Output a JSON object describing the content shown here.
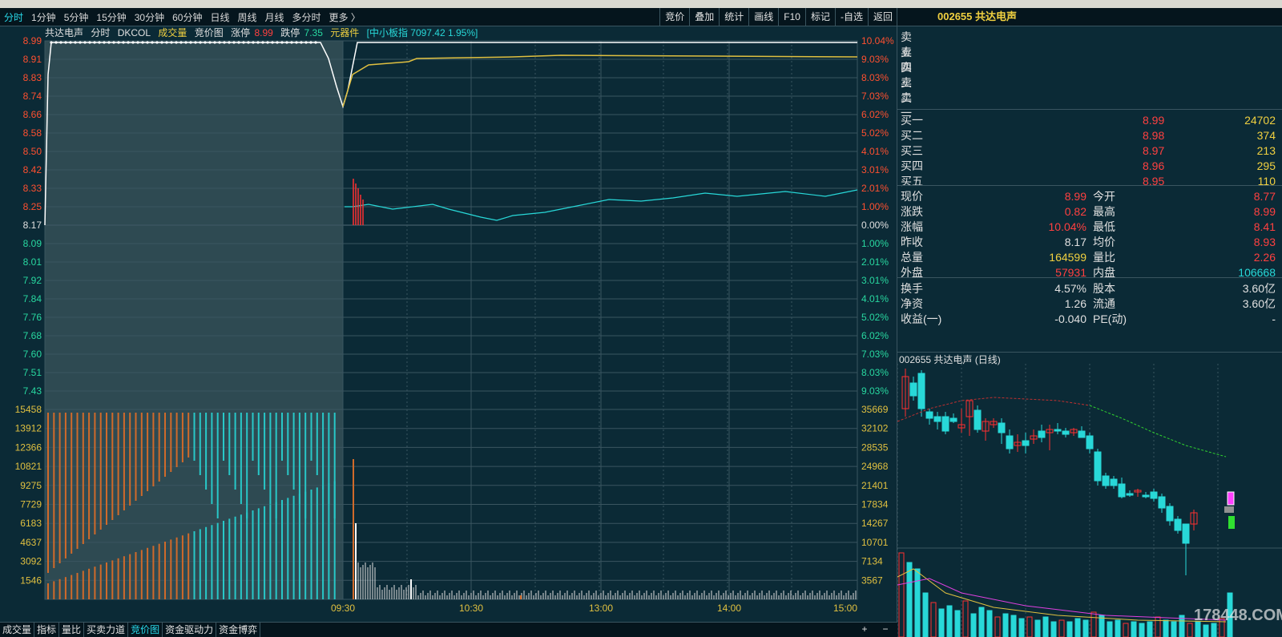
{
  "toolbar": {
    "periods": [
      "分时",
      "1分钟",
      "5分钟",
      "15分钟",
      "30分钟",
      "60分钟",
      "日线",
      "周线",
      "月线",
      "多分时",
      "更多 〉"
    ],
    "right_buttons": [
      "竞价",
      "叠加",
      "统计",
      "画线",
      "F10",
      "标记",
      "-自选",
      "返回"
    ]
  },
  "stock": {
    "code": "002655",
    "name": "共达电声",
    "header": "002655 共达电声"
  },
  "info_bar": {
    "name": "共达电声",
    "mode": "分时",
    "indicator": "DKCOL",
    "vol_label": "成交量",
    "auction_label": "竞价图",
    "limit_up_label": "涨停",
    "limit_up": "8.99",
    "limit_down_label": "跌停",
    "limit_down": "7.35",
    "sector": "元器件",
    "index": "[中小板指 7097.42 1.95%]"
  },
  "price_axis": [
    "8.99",
    "8.91",
    "8.83",
    "8.74",
    "8.66",
    "8.58",
    "8.50",
    "8.42",
    "8.33",
    "8.25",
    "8.17",
    "8.09",
    "8.01",
    "7.92",
    "7.84",
    "7.76",
    "7.68",
    "7.60",
    "7.51",
    "7.43"
  ],
  "pct_axis": [
    "10.04%",
    "9.03%",
    "8.03%",
    "7.03%",
    "6.02%",
    "5.02%",
    "4.01%",
    "3.01%",
    "2.01%",
    "1.00%",
    "0.00%",
    "1.00%",
    "2.01%",
    "3.01%",
    "4.01%",
    "5.02%",
    "6.02%",
    "7.03%",
    "8.03%",
    "9.03%"
  ],
  "vol_axis_left": [
    "15458",
    "13912",
    "12366",
    "10821",
    "9275",
    "7729",
    "6183",
    "4637",
    "3092",
    "1546"
  ],
  "vol_axis_right": [
    "35669",
    "32102",
    "28535",
    "24968",
    "21401",
    "17834",
    "14267",
    "10701",
    "7134",
    "3567"
  ],
  "time_axis": [
    "09:30",
    "10:30",
    "13:00",
    "14:00",
    "15:00"
  ],
  "quote": {
    "sell": [
      {
        "label": "卖五"
      },
      {
        "label": "卖四"
      },
      {
        "label": "卖三"
      },
      {
        "label": "卖二"
      },
      {
        "label": "卖一"
      }
    ],
    "buy": [
      {
        "label": "买一",
        "price": "8.99",
        "vol": "24702"
      },
      {
        "label": "买二",
        "price": "8.98",
        "vol": "374"
      },
      {
        "label": "买三",
        "price": "8.97",
        "vol": "213"
      },
      {
        "label": "买四",
        "price": "8.96",
        "vol": "295"
      },
      {
        "label": "买五",
        "price": "8.95",
        "vol": "110"
      }
    ],
    "stats": [
      {
        "l1": "现价",
        "v1": "8.99",
        "l2": "今开",
        "v2": "8.77",
        "c1": "#ff4040",
        "c2": "#ff4040"
      },
      {
        "l1": "涨跌",
        "v1": "0.82",
        "l2": "最高",
        "v2": "8.99",
        "c1": "#ff4040",
        "c2": "#ff4040"
      },
      {
        "l1": "涨幅",
        "v1": "10.04%",
        "l2": "最低",
        "v2": "8.41",
        "c1": "#ff4040",
        "c2": "#ff4040"
      },
      {
        "l1": "昨收",
        "v1": "8.17",
        "l2": "均价",
        "v2": "8.93",
        "c1": "#e0e0e0",
        "c2": "#ff4040"
      },
      {
        "l1": "总量",
        "v1": "164599",
        "l2": "量比",
        "v2": "2.26",
        "c1": "#f0d040",
        "c2": "#ff4040"
      },
      {
        "l1": "外盘",
        "v1": "57931",
        "l2": "内盘",
        "v2": "106668",
        "c1": "#ff4040",
        "c2": "#28d8d8"
      }
    ],
    "extra": [
      {
        "l1": "换手",
        "v1": "4.57%",
        "l2": "股本",
        "v2": "3.60亿"
      },
      {
        "l1": "净资",
        "v1": "1.26",
        "l2": "流通",
        "v2": "3.60亿"
      },
      {
        "l1": "收益(一)",
        "v1": "-0.040",
        "l2": "PE(动)",
        "v2": "-"
      }
    ]
  },
  "kline_title": "002655 共达电声 (日线)",
  "bottom_tabs": [
    "成交量",
    "指标",
    "量比",
    "买卖力道",
    "竞价图",
    "资金驱动力",
    "资金博弈"
  ],
  "watermark": "178448.COM",
  "colors": {
    "up": "#ff3030",
    "down": "#28d8d8",
    "grid": "#3a5560",
    "avg": "#e0c040",
    "bg": "#0b2a36"
  }
}
